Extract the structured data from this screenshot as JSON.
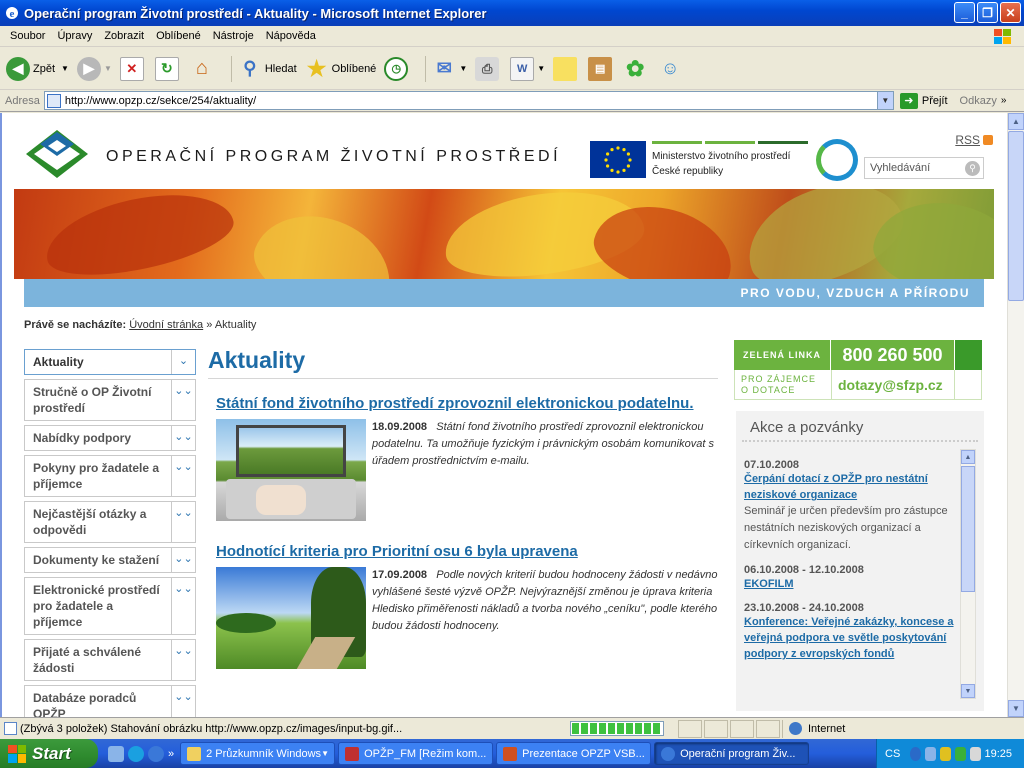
{
  "window": {
    "title": "Operační program Životní prostředí - Aktuality - Microsoft Internet Explorer",
    "minimize": "_",
    "maximize": "❐",
    "close": "✕"
  },
  "menu": [
    "Soubor",
    "Úpravy",
    "Zobrazit",
    "Oblíbené",
    "Nástroje",
    "Nápověda"
  ],
  "toolbar": {
    "back_label": "Zpět",
    "search_label": "Hledat",
    "favorites_label": "Oblíbené"
  },
  "address": {
    "label": "Adresa",
    "url": "http://www.opzp.cz/sekce/254/aktuality/",
    "go_label": "Přejít",
    "links_label": "Odkazy"
  },
  "site": {
    "name": "OPERAČNÍ PROGRAM ŽIVOTNÍ PROSTŘEDÍ",
    "ministry_line1": "Ministerstvo životního prostředí",
    "ministry_line2": "České republiky",
    "rss": "RSS",
    "search_placeholder": "Vyhledávání",
    "slogan": "PRO VODU, VZDUCH A PŘÍRODU"
  },
  "breadcrumb": {
    "prefix": "Právě se nacházíte:",
    "home": "Úvodní stránka",
    "separator": "»",
    "current": "Aktuality"
  },
  "leftnav": [
    {
      "label": "Aktuality",
      "arrow": "⌄"
    },
    {
      "label": "Stručně o OP Životní prostředí",
      "arrow": "»"
    },
    {
      "label": "Nabídky podpory",
      "arrow": "»"
    },
    {
      "label": "Pokyny pro žadatele a příjemce",
      "arrow": "»"
    },
    {
      "label": "Nejčastější otázky a odpovědi",
      "arrow": "»"
    },
    {
      "label": "Dokumenty ke stažení",
      "arrow": "»"
    },
    {
      "label": "Elektronické prostředí pro žadatele a příjemce",
      "arrow": "»"
    },
    {
      "label": "Přijaté a schválené žádosti",
      "arrow": "»"
    },
    {
      "label": "Databáze poradců OPŽP",
      "arrow": "»"
    }
  ],
  "main": {
    "heading": "Aktuality",
    "news": [
      {
        "title": "Státní fond životního prostředí zprovoznil elektronickou podatelnu.",
        "date": "18.09.2008",
        "text": "Státní fond životního prostředí zprovoznil elektronickou podatelnu. Ta umožňuje fyzickým i právnickým osobám komunikovat s úřadem prostřednictvím e-mailu."
      },
      {
        "title": "Hodnotící kriteria pro Prioritní osu 6 byla upravena",
        "date": "17.09.2008",
        "text": "Podle nových kriterií budou hodnoceny žádosti v nedávno vyhlášené šesté výzvě OPŽP. Nejvýraznější změnou je úprava kriteria Hledisko přiměřenosti nákladů a tvorba nového „ceníku\", podle kterého budou žádosti hodnoceny."
      }
    ]
  },
  "hotline": {
    "label": "ZELENÁ LINKA",
    "number": "800 260 500",
    "for_line1": "PRO ZÁJEMCE",
    "for_line2": "O DOTACE",
    "email": "dotazy@sfzp.cz"
  },
  "events": {
    "heading": "Akce a pozvánky",
    "items": [
      {
        "date": "07.10.2008",
        "title": "Čerpání dotací z OPŽP pro nestátní neziskové organizace",
        "desc": "Seminář je určen především pro zástupce nestátních neziskových organizací a církevních organizací."
      },
      {
        "date": "06.10.2008 - 12.10.2008",
        "title": "EKOFILM",
        "desc": ""
      },
      {
        "date": "23.10.2008 - 24.10.2008",
        "title": "Konference: Veřejné zakázky, koncese a veřejná podpora ve světle poskytování podpory z evropských fondů",
        "desc": ""
      }
    ]
  },
  "status": {
    "message": "(Zbývá 3 položek) Stahování obrázku http://www.opzp.cz/images/input-bg.gif...",
    "zone": "Internet",
    "progress": 1.0
  },
  "taskbar": {
    "start": "Start",
    "tasks": [
      {
        "label": "2 Průzkumník Windows",
        "active": false
      },
      {
        "label": "OPŽP_FM [Režim kom...",
        "active": false
      },
      {
        "label": "Prezentace OPZP VSB...",
        "active": false
      },
      {
        "label": "Operační program Živ...",
        "active": true
      }
    ],
    "lang": "CS",
    "time": "19:25"
  }
}
